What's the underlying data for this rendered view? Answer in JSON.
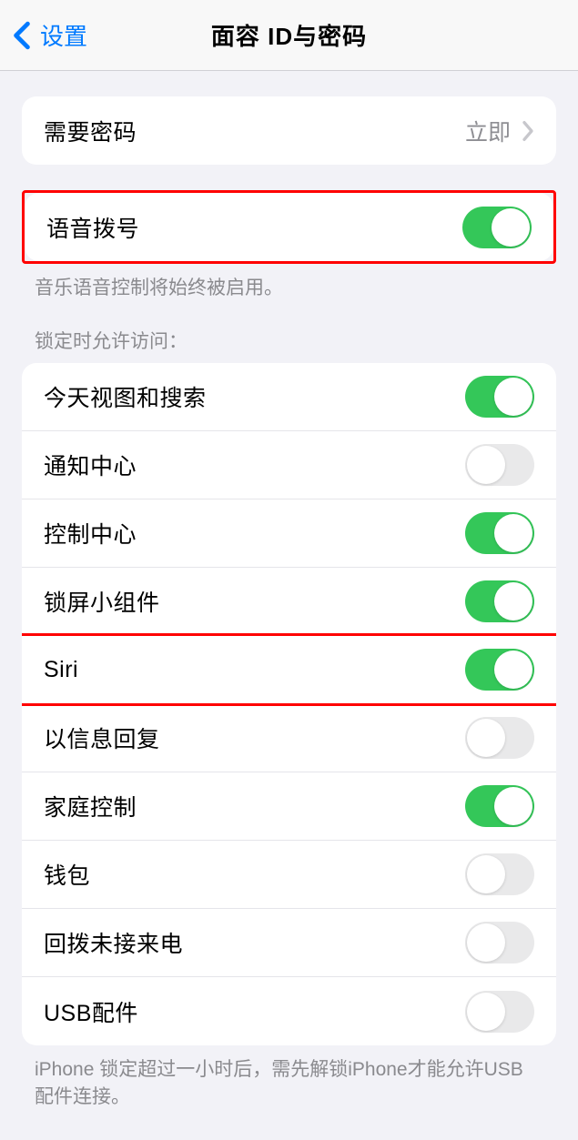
{
  "header": {
    "back_label": "设置",
    "title": "面容 ID与密码"
  },
  "require_passcode": {
    "label": "需要密码",
    "value": "立即"
  },
  "voice_dial": {
    "label": "语音拨号",
    "enabled": true,
    "footer": "音乐语音控制将始终被启用。"
  },
  "lock_access": {
    "header": "锁定时允许访问：",
    "items": [
      {
        "label": "今天视图和搜索",
        "enabled": true
      },
      {
        "label": "通知中心",
        "enabled": false
      },
      {
        "label": "控制中心",
        "enabled": true
      },
      {
        "label": "锁屏小组件",
        "enabled": true
      },
      {
        "label": "Siri",
        "enabled": true
      },
      {
        "label": "以信息回复",
        "enabled": false
      },
      {
        "label": "家庭控制",
        "enabled": true
      },
      {
        "label": "钱包",
        "enabled": false
      },
      {
        "label": "回拨未接来电",
        "enabled": false
      },
      {
        "label": "USB配件",
        "enabled": false
      }
    ],
    "footer": "iPhone 锁定超过一小时后，需先解锁iPhone才能允许USB 配件连接。"
  }
}
